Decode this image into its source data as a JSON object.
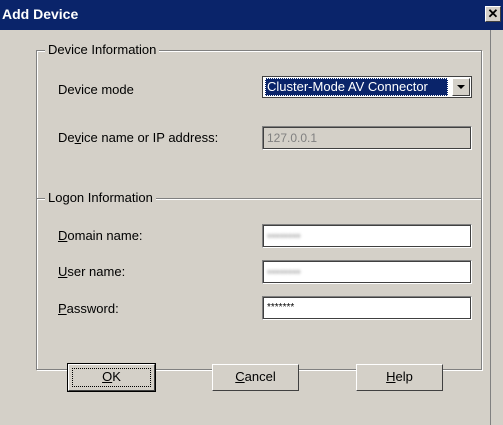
{
  "window": {
    "title": "Add Device",
    "close_glyph": "✕"
  },
  "device_info": {
    "group_title": "Device Information",
    "mode_label": "Device mode",
    "mode_value": "Cluster-Mode AV Connector",
    "name_label_pre": "De",
    "name_label_mn": "v",
    "name_label_post": "ice name or IP address:",
    "name_value": "127.0.0.1"
  },
  "logon_info": {
    "group_title": "Logon Information",
    "domain_label_mn": "D",
    "domain_label_post": "omain name:",
    "domain_value": "••••••••",
    "user_label_mn": "U",
    "user_label_post": "ser name:",
    "user_value": "••••••••",
    "password_label_mn": "P",
    "password_label_post": "assword:",
    "password_value": "*******"
  },
  "buttons": {
    "ok_mn": "O",
    "ok_post": "K",
    "cancel_mn": "C",
    "cancel_post": "ancel",
    "help_mn": "H",
    "help_post": "elp"
  }
}
